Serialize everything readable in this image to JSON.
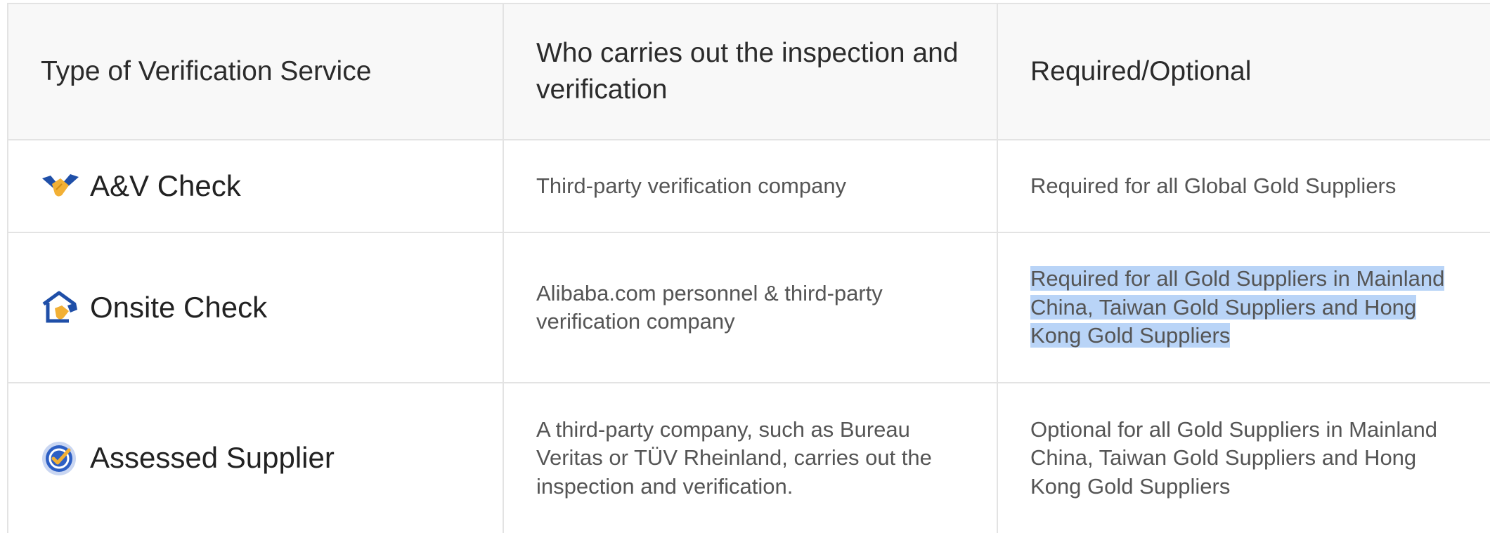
{
  "table": {
    "headers": [
      "Type of Verification Service",
      "Who carries out the inspection and verification",
      "Required/Optional"
    ],
    "rows": [
      {
        "service": "A&V Check",
        "icon": "av-check-handshake-icon",
        "who": "Third-party verification company",
        "requirement": "Required for all Global Gold Suppliers"
      },
      {
        "service": "Onsite Check",
        "icon": "onsite-check-house-icon",
        "who": "Alibaba.com personnel & third-party verification company",
        "requirement": "Required for all Gold Suppliers in Mainland China, Taiwan Gold Suppliers and Hong Kong Gold Suppliers"
      },
      {
        "service": "Assessed Supplier",
        "icon": "assessed-supplier-badge-icon",
        "who": "A third-party company, such as Bureau Veritas or TÜV Rheinland, carries out the inspection and verification.",
        "requirement": "Optional for all Gold Suppliers in Mainland China, Taiwan Gold Suppliers and Hong Kong Gold Suppliers"
      }
    ]
  },
  "selection": {
    "highlight_color": "#b9d4f7"
  },
  "colors": {
    "header_bg": "#f8f8f8",
    "border": "#e3e3e3",
    "icon_blue": "#1f4fa8",
    "icon_gold": "#f2b035"
  }
}
